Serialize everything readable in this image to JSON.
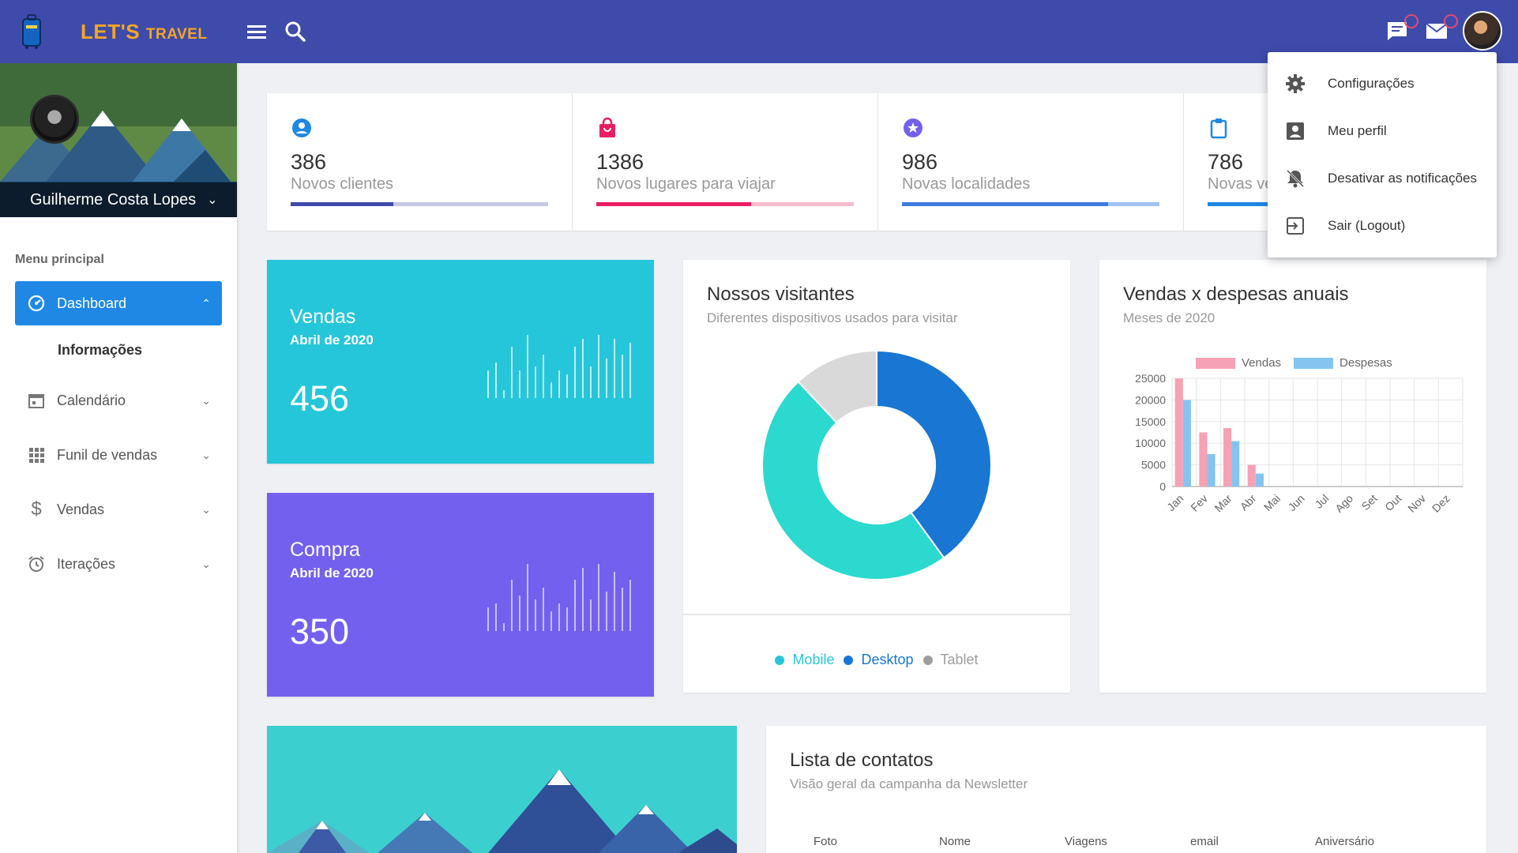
{
  "brand": {
    "name_big": "LET'S",
    "name_small": "TRAVEL"
  },
  "header": {
    "menu_icon": "menu-icon",
    "search_icon": "search-icon",
    "chat_icon": "chat-icon",
    "mail_icon": "mail-icon"
  },
  "profile": {
    "name": "Guilherme Costa Lopes"
  },
  "sidebar": {
    "section_label": "Menu principal",
    "items": [
      {
        "label": "Dashboard",
        "icon": "dashboard-icon"
      },
      {
        "label": "Calendário",
        "icon": "calendar-icon"
      },
      {
        "label": "Funil de vendas",
        "icon": "grid-icon"
      },
      {
        "label": "Vendas",
        "icon": "dollar-icon"
      },
      {
        "label": "Iterações",
        "icon": "alarm-icon"
      }
    ],
    "sub_item": "Informações"
  },
  "stats": [
    {
      "value": "386",
      "label": "Novos clientes",
      "icon": "user-icon",
      "color": "#3f4bab",
      "progress": 0.4
    },
    {
      "value": "1386",
      "label": "Novos lugares para viajar",
      "icon": "bag-icon",
      "color": "#e91e63",
      "progress": 0.6
    },
    {
      "value": "986",
      "label": "Novas localidades",
      "icon": "star-icon",
      "color": "#3f7be0",
      "progress": 0.8
    },
    {
      "value": "786",
      "label": "Novas ve",
      "icon": "clipboard-icon",
      "color": "#1f88e5",
      "progress": 0.5
    }
  ],
  "sales_card": {
    "title": "Vendas",
    "subtitle": "Abril de 2020",
    "value": "456",
    "color": "#26c6da"
  },
  "purchase_card": {
    "title": "Compra",
    "subtitle": "Abril de 2020",
    "value": "350",
    "color": "#7460ee"
  },
  "visitors": {
    "title": "Nossos visitantes",
    "subtitle": "Diferentes dispositivos usados para visitar",
    "legend": [
      {
        "label": "Mobile",
        "color": "#26c6da"
      },
      {
        "label": "Desktop",
        "color": "#1976d2"
      },
      {
        "label": "Tablet",
        "color": "#9e9e9e"
      }
    ]
  },
  "annual": {
    "title": "Vendas x despesas anuais",
    "subtitle": "Meses de 2020",
    "legend_sales": "Vendas",
    "legend_expenses": "Despesas"
  },
  "contacts": {
    "title": "Lista de contatos",
    "subtitle": "Visão geral da campanha da Newsletter",
    "columns": [
      "Foto",
      "Nome",
      "Viagens",
      "email",
      "Aniversário"
    ]
  },
  "dropdown": {
    "items": [
      {
        "label": "Configurações",
        "icon": "gear-icon"
      },
      {
        "label": "Meu perfil",
        "icon": "account-box-icon"
      },
      {
        "label": "Desativar as notificações",
        "icon": "bell-off-icon"
      },
      {
        "label": "Sair (Logout)",
        "icon": "logout-icon"
      }
    ]
  },
  "chart_data": [
    {
      "type": "pie",
      "categories": [
        "Desktop",
        "Mobile",
        "Tablet"
      ],
      "values": [
        40,
        48,
        12
      ],
      "colors": [
        "#1976d2",
        "#2bd9cf",
        "#d9d9d9"
      ]
    },
    {
      "type": "bar",
      "categories": [
        "Jan",
        "Fev",
        "Mar",
        "Abr",
        "Mai",
        "Jun",
        "Jul",
        "Ago",
        "Set",
        "Out",
        "Nov",
        "Dez"
      ],
      "series": [
        {
          "name": "Vendas",
          "values": [
            25000,
            12500,
            13500,
            5000,
            0,
            0,
            0,
            0,
            0,
            0,
            0,
            0
          ],
          "color": "#f7a1b5"
        },
        {
          "name": "Despesas",
          "values": [
            20000,
            7500,
            10500,
            3000,
            0,
            0,
            0,
            0,
            0,
            0,
            0,
            0
          ],
          "color": "#85c4f0"
        }
      ],
      "ylim": [
        0,
        25000
      ],
      "yticks": [
        "25000",
        "20000",
        "15000",
        "10000",
        "5000",
        "0"
      ],
      "grid": true,
      "legend": "top"
    }
  ]
}
